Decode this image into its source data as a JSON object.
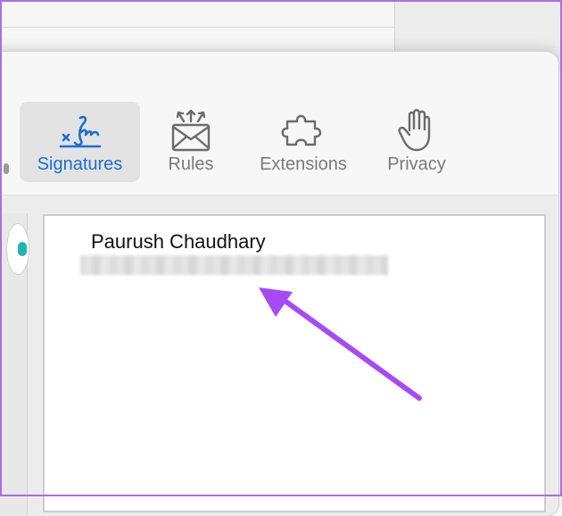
{
  "toolbar": {
    "items": [
      {
        "label": "Signatures",
        "icon": "signature-icon",
        "selected": true
      },
      {
        "label": "Rules",
        "icon": "rules-envelope-icon",
        "selected": false
      },
      {
        "label": "Extensions",
        "icon": "puzzle-icon",
        "selected": false
      },
      {
        "label": "Privacy",
        "icon": "hand-icon",
        "selected": false
      }
    ]
  },
  "signature": {
    "name": "Paurush Chaudhary"
  },
  "colors": {
    "accent": "#1a6fd0",
    "annotation_arrow": "#a64bf4",
    "frame": "#a96fe0"
  }
}
